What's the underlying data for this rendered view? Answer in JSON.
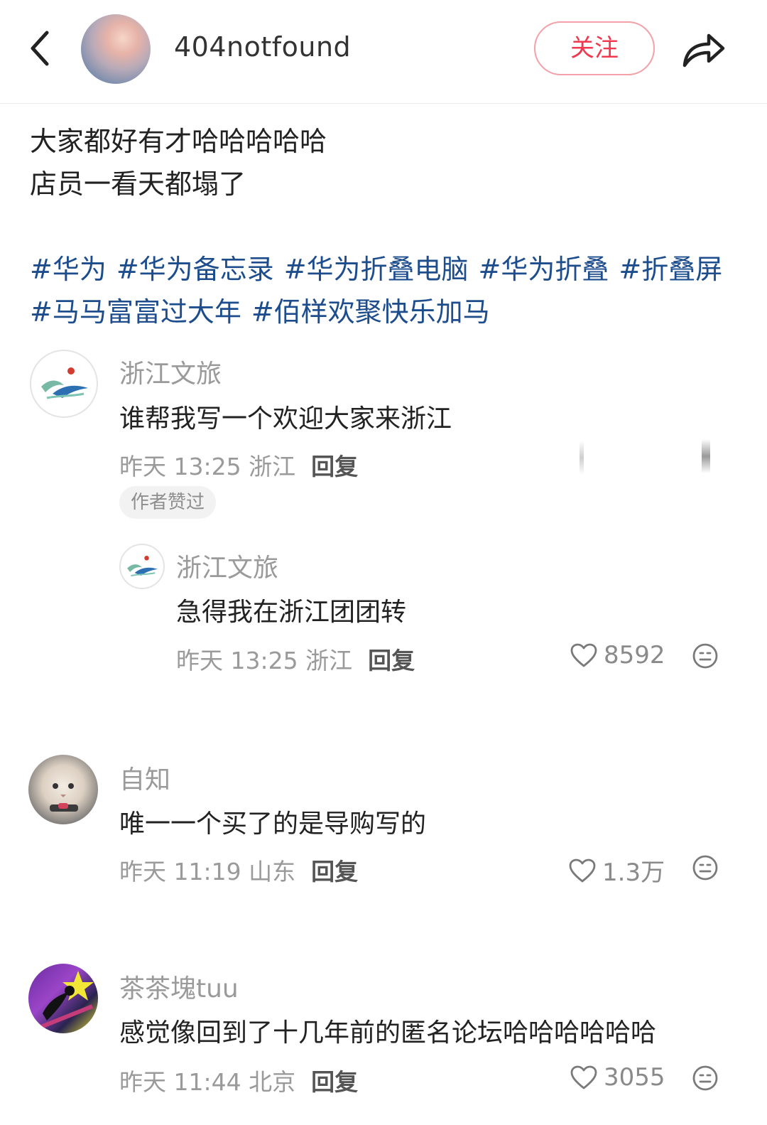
{
  "header": {
    "author_name": "404notfound",
    "follow_label": "关注"
  },
  "post": {
    "lines": [
      "大家都好有才哈哈哈哈哈",
      "店员一看天都塌了"
    ],
    "tags_row1": [
      "#华为",
      "#华为备忘录",
      "#华为折叠电脑",
      "#华为折叠",
      "#折叠屏"
    ],
    "tags_row2": [
      "#马马富富过大年",
      "#佰样欢聚快乐加马"
    ]
  },
  "comments": [
    {
      "author": "浙江文旅",
      "text": "谁帮我写一个欢迎大家来浙江",
      "time": "昨天 13:25 浙江",
      "reply_label": "回复",
      "badge": "作者赞过",
      "replies": [
        {
          "author": "浙江文旅",
          "text": "急得我在浙江团团转",
          "time": "昨天 13:25 浙江",
          "reply_label": "回复",
          "likes": "8592"
        }
      ]
    },
    {
      "author": "自知",
      "text": "唯一一个买了的是导购写的",
      "time": "昨天 11:19 山东",
      "reply_label": "回复",
      "likes": "1.3万"
    },
    {
      "author": "茶茶塊tuu",
      "text": "感觉像回到了十几年前的匿名论坛哈哈哈哈哈哈",
      "time": "昨天 11:44 北京",
      "reply_label": "回复",
      "likes": "3055"
    }
  ],
  "colors": {
    "accent_red": "#f0384e",
    "hashtag_blue": "#1d4d8c",
    "meta_gray": "#9a9a9a"
  }
}
